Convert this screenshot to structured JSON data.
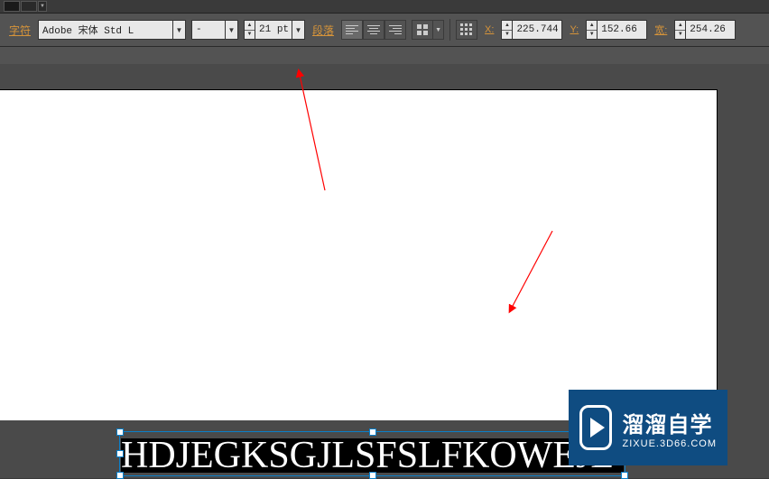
{
  "toolbar": {
    "char_label": "字符",
    "font_family": "Adobe 宋体 Std L",
    "font_style": "-",
    "font_size": "21 pt",
    "paragraph_label": "段落",
    "x_label": "X:",
    "x_value": "225.744",
    "y_label": "Y:",
    "y_value": "152.66 p",
    "w_label": "宽:",
    "w_value": "254.26"
  },
  "canvas": {
    "text_content": "HDJEGKSGJLSFSLFKOWEJE"
  },
  "watermark": {
    "cn": "溜溜自学",
    "en": "ZIXUE.3D66.COM"
  }
}
